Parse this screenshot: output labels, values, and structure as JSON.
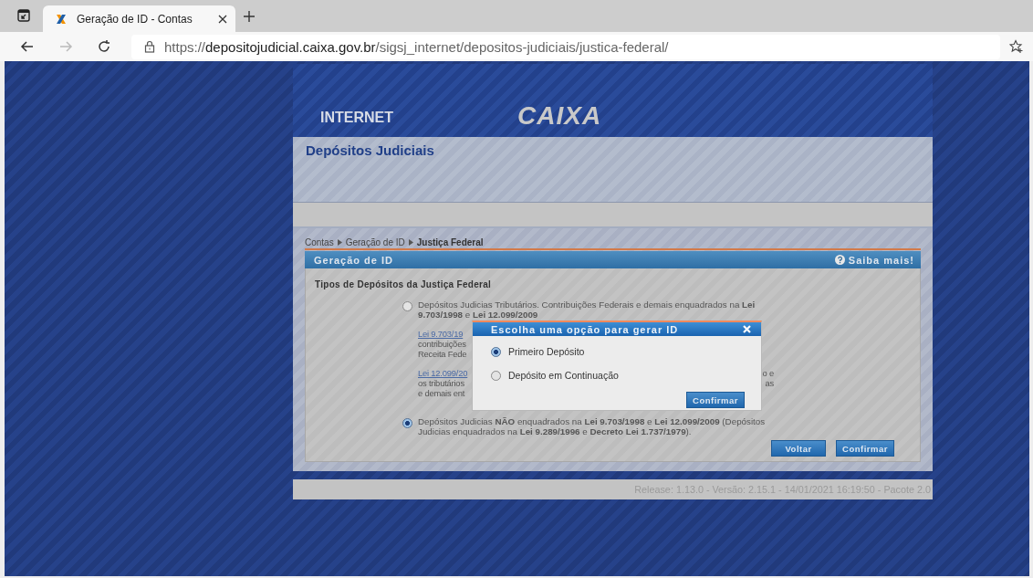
{
  "browser": {
    "tab_title": "Geração de ID - Contas",
    "url_scheme": "https://",
    "url_host": "depositojudicial.caixa.gov.br",
    "url_path": "/sigsj_internet/depositos-judiciais/justica-federal/"
  },
  "header": {
    "section_label": "INTERNET",
    "logo": "CAIXA"
  },
  "page_title": "Depósitos Judiciais",
  "breadcrumb": [
    {
      "label": "Contas",
      "current": false
    },
    {
      "label": "Geração de ID",
      "current": false
    },
    {
      "label": "Justiça Federal",
      "current": true
    }
  ],
  "panel": {
    "title": "Geração de ID",
    "help_link": "Saiba mais!"
  },
  "section_heading": "Tipos de Depósitos da Justiça Federal",
  "options": [
    {
      "selected": false,
      "text": "Depósitos Judicias Tributários. Contribuições Federais e demais enquadrados na **Lei 9.703/1998** e **Lei 12.099/2009**",
      "notes": [
        {
          "lines": [
            {
              "left": "Lei 9.703/19",
              "link": true
            },
            {
              "left": "contribuições",
              "link": false
            },
            {
              "left": "Receita Fede",
              "link": false
            }
          ]
        },
        {
          "lines": [
            {
              "left": "Lei 12.099/20",
              "right": "o e",
              "link": true
            },
            {
              "left": "os tributários",
              "right": "as",
              "link": false
            },
            {
              "left": "e demais ent",
              "link": false
            }
          ]
        }
      ]
    },
    {
      "selected": true,
      "text": "Depósitos Judicias **NÃO** enquadrados na **Lei 9.703/1998** e **Lei 12.099/2009** (Depósitos Judicias enquadrados na **Lei 9.289/1996** e **Decreto Lei 1.737/1979**)."
    }
  ],
  "buttons": [
    "Voltar",
    "Confirmar"
  ],
  "footer": "Release: 1.13.0 - Versão: 2.15.1 - 14/01/2021 16:19:50 - Pacote 2.0",
  "dialog": {
    "title": "Escolha uma opção para gerar ID",
    "options": [
      {
        "label": "Primeiro Depósito",
        "selected": true
      },
      {
        "label": "Depósito em Continuação",
        "selected": false
      }
    ],
    "button": "Confirmar"
  }
}
